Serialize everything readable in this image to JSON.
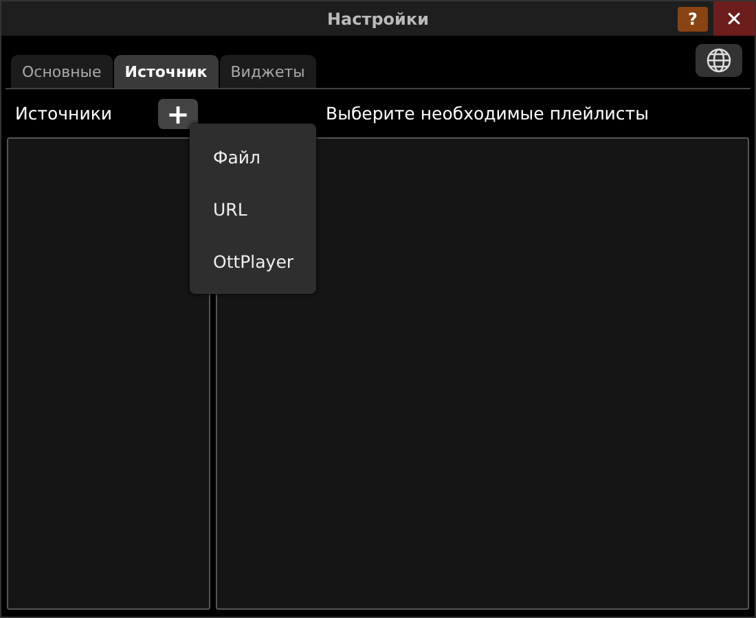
{
  "window": {
    "title": "Настройки",
    "help_label": "?",
    "close_label": "✕"
  },
  "tabs": [
    {
      "label": "Основные",
      "selected": false
    },
    {
      "label": "Источник",
      "selected": true
    },
    {
      "label": "Виджеты",
      "selected": false
    }
  ],
  "sources": {
    "title": "Источники",
    "add_label": "+"
  },
  "playlists": {
    "title": "Выберите необходимые плейлисты"
  },
  "menu": {
    "items": [
      "Файл",
      "URL",
      "OttPlayer"
    ]
  }
}
